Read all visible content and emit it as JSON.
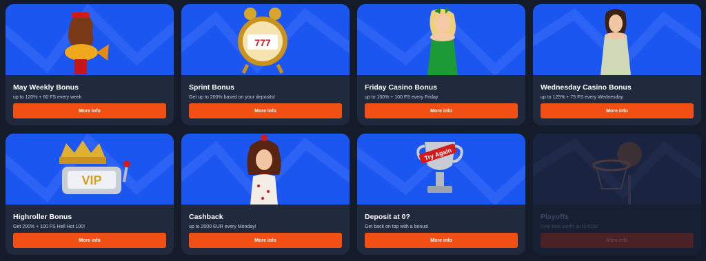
{
  "promotions": [
    {
      "title": "May Weekly Bonus",
      "description": "up to 120% + 60 FS every week",
      "button": "More info",
      "image": "mermaid-woman-with-golden-fish-icon",
      "disabled": false
    },
    {
      "title": "Sprint Bonus",
      "description": "Get up to 200% based on your deposits!",
      "button": "More info",
      "image": "alarm-clock-slot-777-icon",
      "disabled": false
    },
    {
      "title": "Friday Casino Bonus",
      "description": "up to 150% + 100 FS every Friday",
      "button": "More info",
      "image": "blonde-woman-green-dress-icon",
      "disabled": false
    },
    {
      "title": "Wednesday Casino Bonus",
      "description": "up to 125% + 75 FS every Wednesday",
      "button": "More info",
      "image": "woman-silver-dress-icon",
      "disabled": false
    },
    {
      "title": "Highroller Bonus",
      "description": "Get 200% + 100 FS Hell Hot 100!",
      "button": "More info",
      "image": "vip-crown-slot-icon",
      "disabled": false
    },
    {
      "title": "Cashback",
      "description": "up to 2000 EUR every Monday!",
      "button": "More info",
      "image": "pinup-woman-icon",
      "disabled": false
    },
    {
      "title": "Deposit at 0?",
      "description": "Get back on top with a bonus!",
      "button": "More info",
      "image": "try-again-trophy-icon",
      "disabled": false
    },
    {
      "title": "Playoffs",
      "description": "Free bets worth up to €150",
      "button": "More info",
      "image": "basketball-hoop-icon",
      "disabled": true
    }
  ],
  "colors": {
    "banner": "#1b56f0",
    "button": "#f24f14",
    "card": "#202a3c",
    "page": "#141b2b"
  }
}
